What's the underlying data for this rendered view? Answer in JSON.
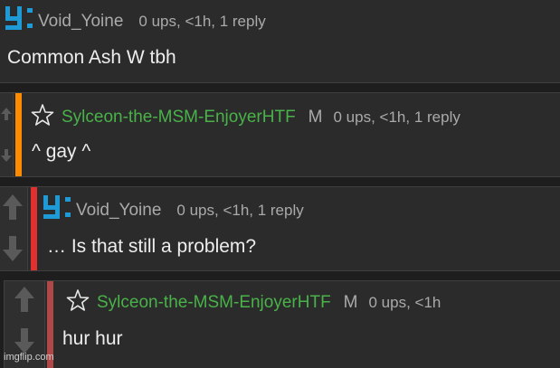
{
  "thread": [
    {
      "username": "Void_Yoine",
      "meta": "0 ups, <1h, 1 reply",
      "text": "Common Ash W tbh",
      "avatar": "yoine-logo-icon"
    },
    {
      "username": "Sylceon-the-MSM-EnjoyerHTF",
      "badge": "M",
      "meta": "0 ups, <1h, 1 reply",
      "text": "^ gay ^",
      "avatar": "star-icon",
      "bar_color": "#ff8c00"
    },
    {
      "username": "Void_Yoine",
      "meta": "0 ups, <1h, 1 reply",
      "text": "… Is that still a problem?",
      "avatar": "yoine-logo-icon",
      "bar_color": "#e03030"
    },
    {
      "username": "Sylceon-the-MSM-EnjoyerHTF",
      "badge": "M",
      "meta": "0 ups, <1h",
      "text": "hur hur",
      "avatar": "star-icon",
      "bar_color": "#b04848"
    }
  ],
  "colors": {
    "logo": "#1e9bd7",
    "username_green": "#49b249",
    "muted": "#aaaaaa"
  },
  "watermark": "imgflip.com"
}
